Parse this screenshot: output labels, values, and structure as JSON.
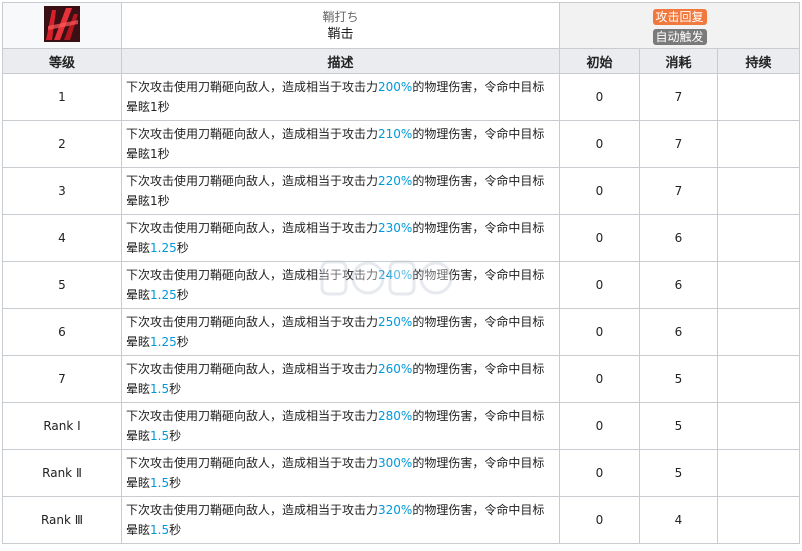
{
  "skill": {
    "name_jp": "鞘打ち",
    "name_cn": "鞘击",
    "icon": "skill-icon-red-slash",
    "tags": [
      "攻击回复",
      "自动触发"
    ]
  },
  "headers": {
    "level": "等级",
    "desc": "描述",
    "initial": "初始",
    "cost": "消耗",
    "duration": "持续"
  },
  "desc_parts": {
    "pre": "下次攻击使用刀鞘砸向敌人，造成相当于攻击力",
    "mid": "的物理伤害，令命中目标晕眩",
    "post": "秒"
  },
  "rows": [
    {
      "level": "1",
      "pct": "200%",
      "stun": "1",
      "stun_hl": false,
      "initial": "0",
      "cost": "7",
      "duration": ""
    },
    {
      "level": "2",
      "pct": "210%",
      "stun": "1",
      "stun_hl": false,
      "initial": "0",
      "cost": "7",
      "duration": ""
    },
    {
      "level": "3",
      "pct": "220%",
      "stun": "1",
      "stun_hl": false,
      "initial": "0",
      "cost": "7",
      "duration": ""
    },
    {
      "level": "4",
      "pct": "230%",
      "stun": "1.25",
      "stun_hl": true,
      "initial": "0",
      "cost": "6",
      "duration": ""
    },
    {
      "level": "5",
      "pct": "240%",
      "stun": "1.25",
      "stun_hl": true,
      "initial": "0",
      "cost": "6",
      "duration": ""
    },
    {
      "level": "6",
      "pct": "250%",
      "stun": "1.25",
      "stun_hl": true,
      "initial": "0",
      "cost": "6",
      "duration": ""
    },
    {
      "level": "7",
      "pct": "260%",
      "stun": "1.5",
      "stun_hl": true,
      "initial": "0",
      "cost": "5",
      "duration": ""
    },
    {
      "level": "Rank Ⅰ",
      "pct": "280%",
      "stun": "1.5",
      "stun_hl": true,
      "initial": "0",
      "cost": "5",
      "duration": ""
    },
    {
      "level": "Rank Ⅱ",
      "pct": "300%",
      "stun": "1.5",
      "stun_hl": true,
      "initial": "0",
      "cost": "5",
      "duration": ""
    },
    {
      "level": "Rank Ⅲ",
      "pct": "320%",
      "stun": "1.5",
      "stun_hl": true,
      "initial": "0",
      "cost": "4",
      "duration": ""
    }
  ],
  "colors": {
    "highlight": "#0098dc",
    "tag_sp": "#f2793d",
    "tag_trigger": "#7a7a7a",
    "header_bg": "#eaecf0"
  }
}
